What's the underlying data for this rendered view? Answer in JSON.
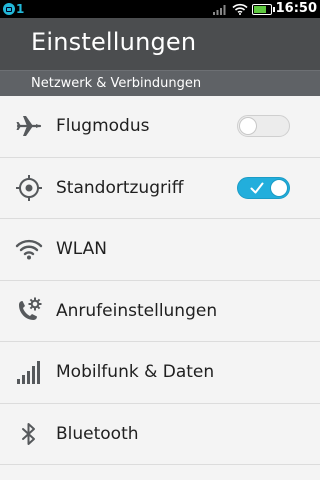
{
  "status_bar": {
    "notification_count": "1",
    "time": "16:50",
    "icons": [
      "signal-icon",
      "wifi-icon",
      "battery-icon"
    ],
    "battery_level": 0.8
  },
  "header": {
    "title": "Einstellungen"
  },
  "section": {
    "label": "Netzwerk & Verbindungen"
  },
  "items": [
    {
      "label": "Flugmodus",
      "icon": "airplane-icon",
      "toggle": "off"
    },
    {
      "label": "Standortzugriff",
      "icon": "location-icon",
      "toggle": "on"
    },
    {
      "label": "WLAN",
      "icon": "wifi-icon"
    },
    {
      "label": "Anrufeinstellungen",
      "icon": "phone-settings-icon"
    },
    {
      "label": "Mobilfunk & Daten",
      "icon": "cellular-icon"
    },
    {
      "label": "Bluetooth",
      "icon": "bluetooth-icon"
    }
  ],
  "colors": {
    "accent": "#22aedc",
    "header": "#4b4d4f",
    "section": "#5f6266",
    "background": "#f4f4f4"
  }
}
